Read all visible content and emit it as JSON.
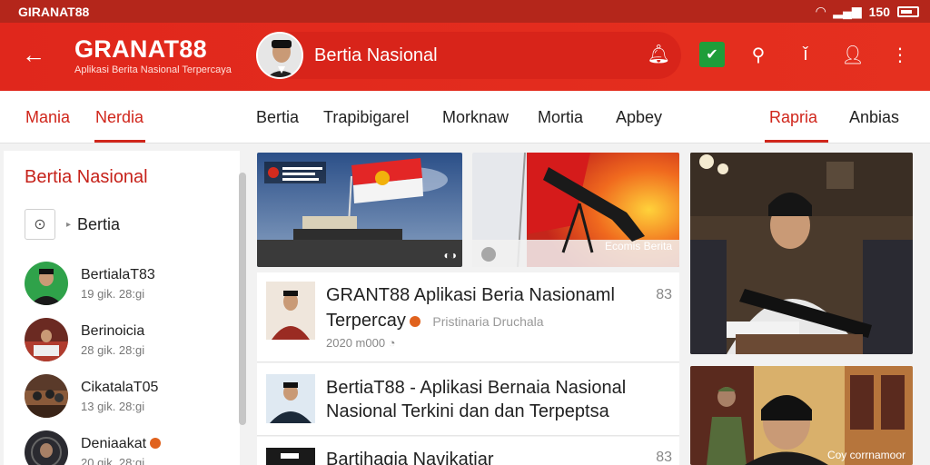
{
  "statusbar": {
    "carrier": "GIRANAT88",
    "time": "150"
  },
  "appbar": {
    "brand": "GRANAT88",
    "brand_sub": "Aplikasi Berita Nasional Terpercaya",
    "pill_title": "Bertia Nasional",
    "icons": [
      "back-arrow-icon",
      "bell-icon",
      "flag-icon",
      "search-icon",
      "info-icon",
      "profile-icon",
      "more-icon"
    ]
  },
  "nav": {
    "tabs": [
      "Mania",
      "Nerdia",
      "Bertia",
      "Trapibigarel",
      "Morknaw",
      "Mortia",
      "Apbey",
      "Rapria",
      "Anbias"
    ]
  },
  "sidebar": {
    "title": "Bertia Nasional",
    "filter_label": "Bertia",
    "items": [
      {
        "name": "BertialaT83",
        "meta": "19 gik. 28:gi"
      },
      {
        "name": "Berinoicia",
        "meta": "28 gik. 28:gi"
      },
      {
        "name": "CikatalaT05",
        "meta": "13 gik. 28:gi"
      },
      {
        "name": "Deniaakat",
        "meta": "20 gik. 28:gi"
      }
    ]
  },
  "main": {
    "card1_overlay": "◐◑",
    "card2_overlay": "Ecomis Berita",
    "news": [
      {
        "title_line1": "GRANT88 Aplikasi Beria Nasionaml",
        "title_line2": "Terpercay",
        "source": "Pristinaria Druchala",
        "meta": "2020 m000 ◔",
        "count": "83"
      },
      {
        "title_line1": "BertiaT88 - Aplikasi Bernaia Nasional",
        "title_line2": "Nasional Terkini dan dan Terpeptsa",
        "count": ""
      },
      {
        "title_line1": "Bartihagia Navikatiar",
        "count": "83"
      }
    ],
    "right_overlay": "Coy corrnamoor"
  }
}
